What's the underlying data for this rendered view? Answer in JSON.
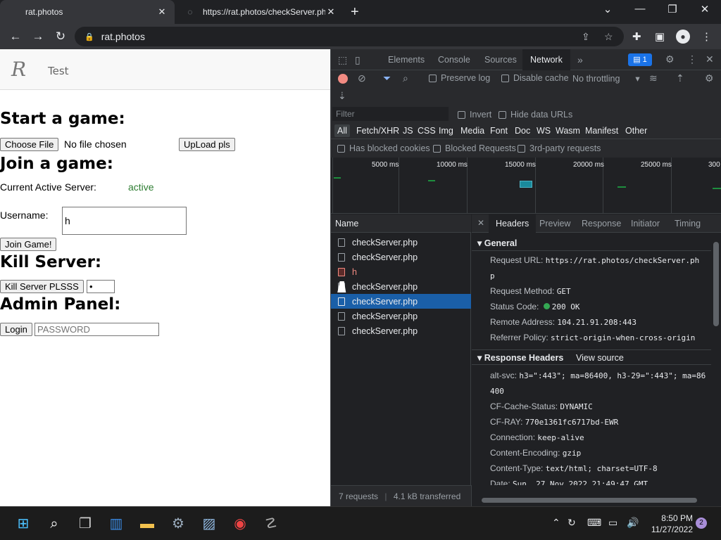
{
  "browser": {
    "tabs": [
      {
        "title": "rat.photos",
        "active": true
      },
      {
        "title": "https://rat.photos/checkServer.ph",
        "active": false
      }
    ],
    "url": "rat.photos"
  },
  "page": {
    "header_text": "Test",
    "logo_text": "R",
    "start_title": "Start a game:",
    "choose_file_label": "Choose File",
    "no_file_text": "No file chosen",
    "upload_label": "UpLoad pls",
    "join_title": "Join a game:",
    "server_label": "Current Active Server:",
    "server_status": "active",
    "username_label": "Username:",
    "username_value": "h",
    "join_button": "Join Game!",
    "kill_title": "Kill Server:",
    "kill_button": "Kill Server PLSSS",
    "kill_value": "•",
    "admin_title": "Admin Panel:",
    "login_button": "Login",
    "password_placeholder": "PASSWORD"
  },
  "devtools": {
    "tabs": [
      "Elements",
      "Console",
      "Sources",
      "Network"
    ],
    "active_tab": "Network",
    "issues_count": "1",
    "preserve_log": "Preserve log",
    "disable_cache": "Disable cache",
    "throttling": "No throttling",
    "filter_placeholder": "Filter",
    "invert": "Invert",
    "hide_data_urls": "Hide data URLs",
    "types": [
      "All",
      "Fetch/XHR",
      "JS",
      "CSS",
      "Img",
      "Media",
      "Font",
      "Doc",
      "WS",
      "Wasm",
      "Manifest",
      "Other"
    ],
    "has_blocked_cookies": "Has blocked cookies",
    "blocked_requests": "Blocked Requests",
    "third_party": "3rd-party requests",
    "timeline_labels": [
      "5000 ms",
      "10000 ms",
      "15000 ms",
      "20000 ms",
      "25000 ms",
      "300"
    ],
    "name_header": "Name",
    "requests": [
      {
        "name": "checkServer.php",
        "state": "normal"
      },
      {
        "name": "checkServer.php",
        "state": "normal"
      },
      {
        "name": "h",
        "state": "error"
      },
      {
        "name": "checkServer.php",
        "state": "normal"
      },
      {
        "name": "checkServer.php",
        "state": "selected"
      },
      {
        "name": "checkServer.php",
        "state": "normal"
      },
      {
        "name": "checkServer.php",
        "state": "normal"
      }
    ],
    "detail_tabs": [
      "Headers",
      "Preview",
      "Response",
      "Initiator",
      "Timing"
    ],
    "general_title": "General",
    "general": {
      "request_url_key": "Request URL:",
      "request_url_1": "https://rat.photos/checkServer.ph",
      "request_url_2": "p",
      "method_key": "Request Method:",
      "method": "GET",
      "status_key": "Status Code:",
      "status": "200 OK",
      "remote_key": "Remote Address:",
      "remote": "104.21.91.208:443",
      "referrer_key": "Referrer Policy:",
      "referrer": "strict-origin-when-cross-origin"
    },
    "response_title": "Response Headers",
    "view_source": "View source",
    "response": {
      "altsvc_key": "alt-svc:",
      "altsvc_1": "h3=\":443\"; ma=86400, h3-29=\":443\"; ma=86",
      "altsvc_2": "400",
      "cfcache_key": "CF-Cache-Status:",
      "cfcache": "DYNAMIC",
      "cfray_key": "CF-RAY:",
      "cfray": "770e1361fc6717bd-EWR",
      "conn_key": "Connection:",
      "conn": "keep-alive",
      "enc_key": "Content-Encoding:",
      "enc": "gzip",
      "ctype_key": "Content-Type:",
      "ctype": "text/html; charset=UTF-8",
      "date_key": "Date:",
      "date": "Sun, 27 Nov 2022 21:49:47 GMT"
    },
    "status_requests": "7 requests",
    "status_transferred": "4.1 kB transferred"
  },
  "taskbar": {
    "time": "8:50 PM",
    "date": "11/27/2022",
    "notifications": "2"
  }
}
